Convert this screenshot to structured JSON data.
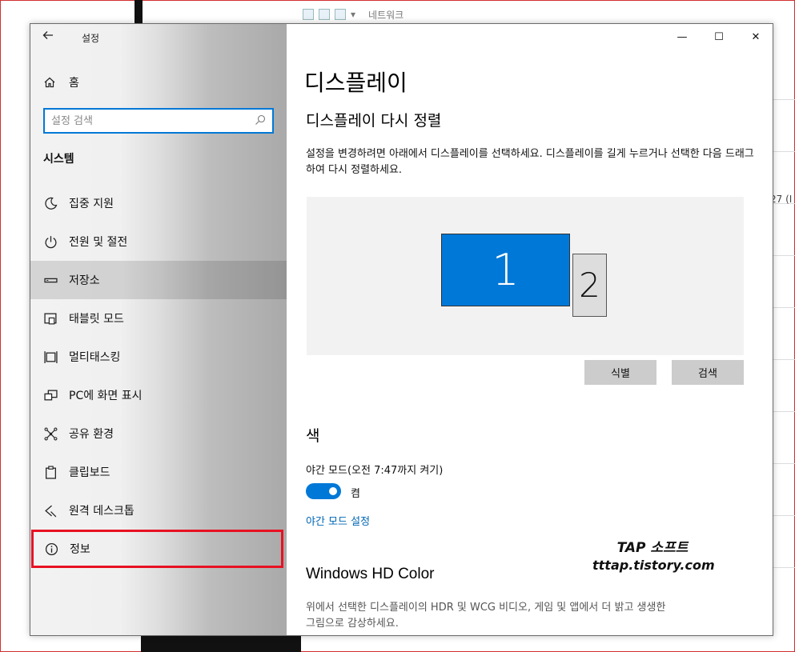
{
  "background": {
    "explorer_breadcrumb": "네트워크",
    "side_fragment": "27 (I"
  },
  "window": {
    "app_title": "설정",
    "caption": {
      "minimize": "—",
      "maximize": "☐",
      "close": "✕"
    }
  },
  "sidebar": {
    "home_label": "홈",
    "search_placeholder": "설정 검색",
    "section_title": "시스템",
    "items": [
      {
        "label": "집중 지원",
        "icon": "moon-icon"
      },
      {
        "label": "전원 및 절전",
        "icon": "power-icon"
      },
      {
        "label": "저장소",
        "icon": "storage-icon"
      },
      {
        "label": "태블릿 모드",
        "icon": "tablet-icon"
      },
      {
        "label": "멀티태스킹",
        "icon": "multitasking-icon"
      },
      {
        "label": "PC에 화면 표시",
        "icon": "project-icon"
      },
      {
        "label": "공유 환경",
        "icon": "share-icon"
      },
      {
        "label": "클립보드",
        "icon": "clipboard-icon"
      },
      {
        "label": "원격 데스크톱",
        "icon": "remote-desktop-icon"
      },
      {
        "label": "정보",
        "icon": "info-icon"
      }
    ]
  },
  "main": {
    "page_title": "디스플레이",
    "rearrange_title": "디스플레이 다시 정렬",
    "rearrange_desc": "설정을 변경하려면 아래에서 디스플레이를 선택하세요. 디스플레이를 길게 누르거나 선택한 다음 드래그하여 다시 정렬하세요.",
    "monitors": [
      "1",
      "2"
    ],
    "identify_button": "식별",
    "detect_button": "검색",
    "color_title": "색",
    "night_light_label": "야간 모드(오전 7:47까지 켜기)",
    "night_light_state": "켬",
    "night_light_link": "야간 모드 설정",
    "hd_title": "Windows HD Color",
    "hd_desc": "위에서 선택한 디스플레이의 HDR 및 WCG 비디오, 게임 및 앱에서 더 밝고 생생한 그림으로 감상하세요."
  },
  "watermark": {
    "line1": "TAP 소프트",
    "line2": "tttap.tistory.com"
  },
  "colors": {
    "accent": "#0078d7",
    "selection_outline": "#e81123",
    "link": "#0066b4"
  }
}
